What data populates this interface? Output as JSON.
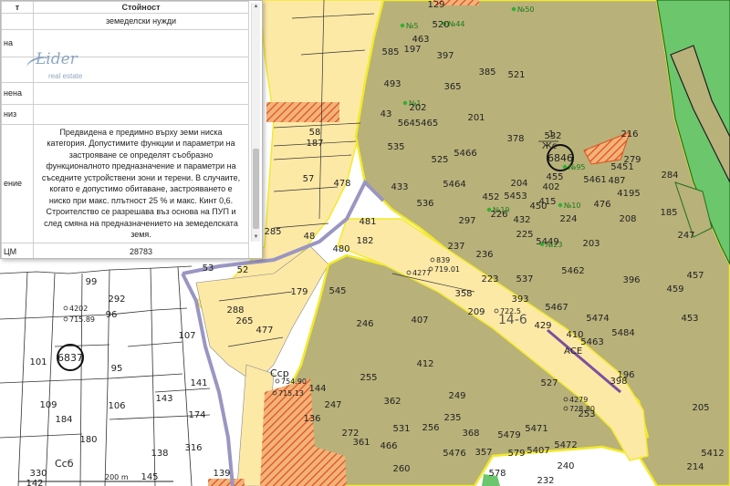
{
  "panel": {
    "header": "Стойност",
    "row1_partial": "земеделски нужди",
    "keys": [
      "на",
      "нена",
      "низ",
      "ение",
      "ЦМ"
    ],
    "description": "Предвидена е предимно върху земи ниска категория. Допустимите функции и параметри на застрояване се определят съобразно функционалното предназначение и параметри на съседните устройствени зони и терени. В случаите, когато е допустимо обитаване, застрояването е ниско при макс. плътност 25 % и макс. Кинт 0,6. Строителство се разрешава въз основа на ПУП и след смяна на предназначението на земеделската земя.",
    "value": "28783",
    "logo_main": "Lider",
    "logo_sub": "real estate"
  },
  "map": {
    "marked_plots": [
      "6846",
      "6837"
    ],
    "marked_plot_notes": [
      "1",
      "Жс"
    ],
    "ac_label": "АСЕ",
    "zone_label": "14-6",
    "scale_label": "200 m",
    "sym_ssb": "Сcб",
    "sym_ssr": "Сcр",
    "elevations": [
      "4202",
      "715.89",
      "4277",
      "839",
      "719.01",
      "722.5",
      "4279",
      "728.80",
      "754.90",
      "715.13"
    ],
    "green_points": [
      "№5",
      "№44",
      "№50",
      "№1",
      "№95",
      "№10",
      "№19",
      "№23"
    ],
    "colors": {
      "agri": "#b8b17a",
      "light": "#faeaa5",
      "zone_border": "#f2ea2a",
      "hatch": "#e5602a",
      "road": "#9a96c2",
      "forest": "#6cc66c"
    }
  },
  "plots": [
    [
      "129",
      "463",
      "520",
      "585",
      "197",
      "493",
      "397",
      "365",
      "521",
      "43",
      "202",
      "385",
      "201",
      "5645465",
      "535",
      "525",
      "5466",
      "378",
      "532",
      "415",
      "433",
      "5464",
      "402",
      "452",
      "5453",
      "204",
      "536",
      "450",
      "297",
      "226",
      "432",
      "225",
      "5449",
      "224",
      "237",
      "236",
      "5462",
      "537",
      "223",
      "545",
      "358",
      "393",
      "5467",
      "396",
      "209",
      "246",
      "407",
      "429",
      "5474",
      "5463",
      "5484",
      "5451",
      "487",
      "5461",
      "476",
      "455",
      "288",
      "179",
      "265",
      "477",
      "48",
      "182",
      "57",
      "187",
      "58",
      "478",
      "481",
      "480",
      "53",
      "52",
      "285",
      "292",
      "99",
      "96",
      "107",
      "101",
      "95",
      "109",
      "106",
      "141",
      "143",
      "174",
      "180",
      "184",
      "330",
      "142",
      "139",
      "138",
      "316",
      "145",
      "144",
      "136",
      "247",
      "272",
      "361",
      "362",
      "412",
      "256",
      "249",
      "255",
      "260",
      "357",
      "579",
      "253",
      "398",
      "196",
      "410",
      "527",
      "578",
      "232",
      "216",
      "279",
      "208",
      "4195",
      "203",
      "185",
      "459",
      "457",
      "453",
      "205",
      "214",
      "5412",
      "5407",
      "5472",
      "5476",
      "5479",
      "5471",
      "368",
      "466",
      "531",
      "235",
      "240",
      "247",
      "284",
      "291",
      "300",
      "366",
      "469",
      "542",
      "5473",
      "5432",
      "215",
      "298"
    ]
  ]
}
